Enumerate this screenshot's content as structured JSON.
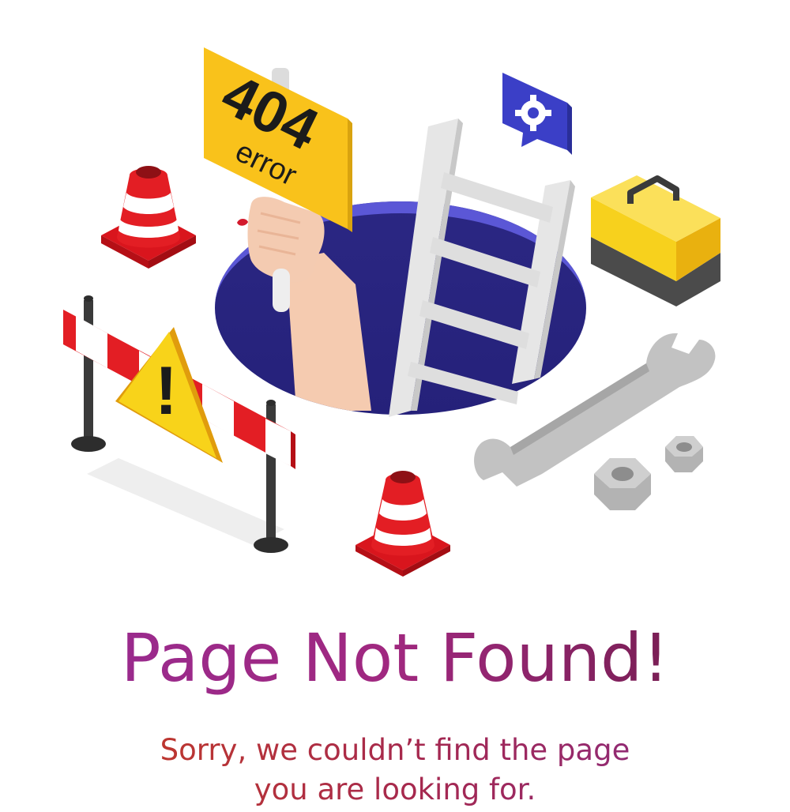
{
  "illustration": {
    "sign_number": "404",
    "sign_word": "error",
    "warning_symbol": "!",
    "icons": [
      "traffic-cone-icon",
      "barrier-icon",
      "warning-sign-icon",
      "ladder-icon",
      "toolbox-icon",
      "wrench-icon",
      "nut-icon",
      "gear-chat-icon",
      "hand-icon",
      "manhole-icon"
    ]
  },
  "title": "Page Not Found!",
  "message": {
    "line1": "Sorry, we couldn’t find the page",
    "line2": "you are looking for."
  },
  "colors": {
    "title": "#9a2a8d",
    "subtitle": "#b53245",
    "hole": "#2e2a8f",
    "hole_rim": "#5b57d6",
    "sign": "#f9c21b",
    "cone_red": "#e31e24",
    "toolbox_yellow": "#f7d11d",
    "tool_gray": "#b9b9b9"
  }
}
